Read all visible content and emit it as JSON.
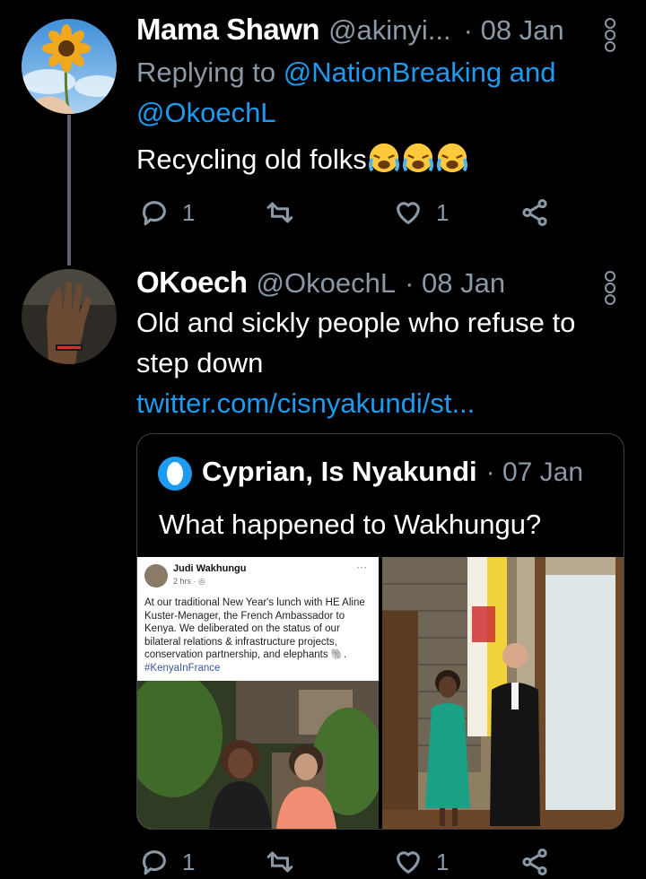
{
  "tweet1": {
    "author_name": "Mama Shawn",
    "handle": "@akinyi...",
    "date": "· 08 Jan",
    "replying_prefix": "Replying to ",
    "replying_to_line1": "@NationBreaking and",
    "replying_to_line2": "@OkoechL",
    "text": "Recycling old folks",
    "emoji": "crying-face-emoji",
    "reply_count": "1",
    "like_count": "1"
  },
  "tweet2": {
    "author_name": "OKoech",
    "handle": "@OkoechL",
    "date": "· 08 Jan",
    "text_line1": "Old and sickly people who refuse to",
    "text_line2": "step down",
    "link": "twitter.com/cisnyakundi/st...",
    "reply_count": "1",
    "like_count": "1"
  },
  "quoted": {
    "author_name": "Cyprian, Is Nyakundi",
    "date": "· 07 Jan",
    "text": "What happened to Wakhungu?",
    "fb_post": {
      "author": "Judi Wakhungu",
      "meta": "2 hrs · ",
      "menu": "···",
      "body": "At our traditional New Year's lunch with HE Aline Kuster-Menager, the French Ambassador to Kenya. We deliberated on the status of our bilateral relations & infrastructure projects, conservation partnership, and elephants",
      "hashtag": "#KenyaInFrance"
    }
  },
  "colors": {
    "background": "#000000",
    "link": "#1d9bf0",
    "muted": "#8b98a5"
  }
}
